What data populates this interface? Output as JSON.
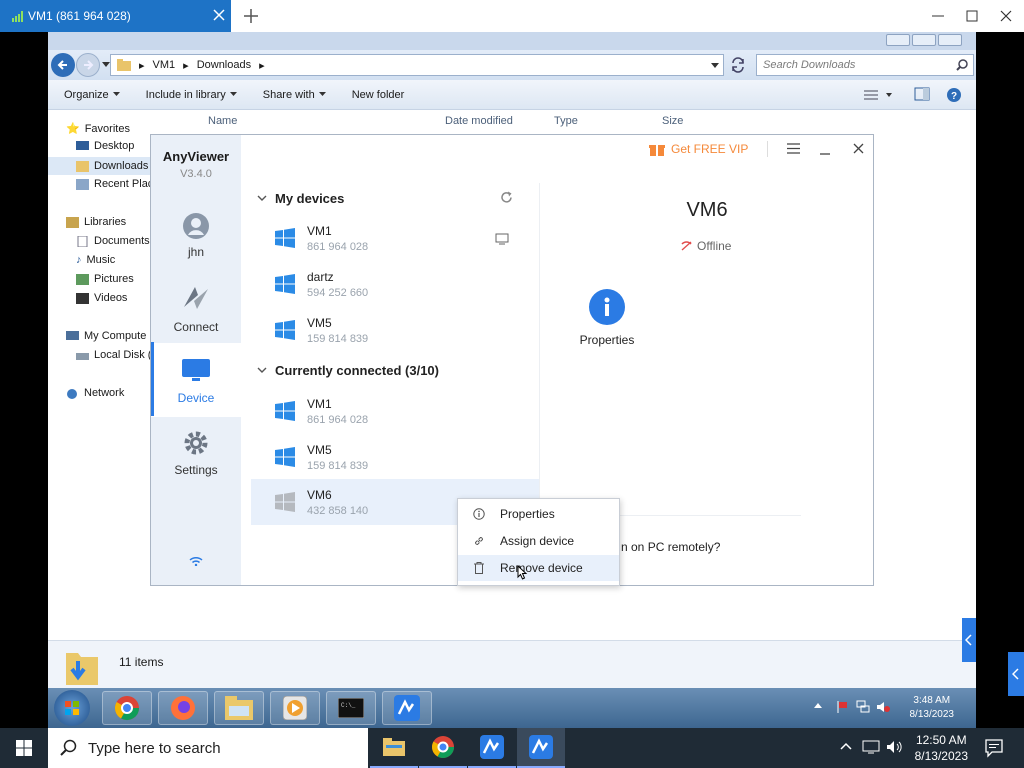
{
  "host": {
    "tab_title": "VM1 (861 964 028)",
    "search_placeholder": "Type here to search",
    "clock_time": "12:50 AM",
    "clock_date": "8/13/2023"
  },
  "explorer": {
    "breadcrumb": [
      "VM1",
      "Downloads"
    ],
    "search_placeholder": "Search Downloads",
    "toolbar": {
      "organize": "Organize",
      "include": "Include in library",
      "share": "Share with",
      "new_folder": "New folder"
    },
    "nav": {
      "favorites": "Favorites",
      "desktop": "Desktop",
      "downloads": "Downloads",
      "recent": "Recent Plac",
      "libraries": "Libraries",
      "documents": "Documents",
      "music": "Music",
      "pictures": "Pictures",
      "videos": "Videos",
      "computer": "My Compute",
      "local_disk": "Local Disk (",
      "network": "Network"
    },
    "columns": {
      "name": "Name",
      "date": "Date modified",
      "type": "Type",
      "size": "Size"
    },
    "status": "11 items"
  },
  "guest": {
    "clock_time": "3:48 AM",
    "clock_date": "8/13/2023"
  },
  "anyviewer": {
    "app_name": "AnyViewer",
    "version": "V3.4.0",
    "vip": "Get FREE VIP",
    "user": "jhn",
    "nav": {
      "connect": "Connect",
      "device": "Device",
      "settings": "Settings"
    },
    "my_devices": "My devices",
    "devices": [
      {
        "name": "VM1",
        "id": "861 964 028"
      },
      {
        "name": "dartz",
        "id": "594 252 660"
      },
      {
        "name": "VM5",
        "id": "159 814 839"
      }
    ],
    "connected_header": "Currently connected (3/10)",
    "connected": [
      {
        "name": "VM1",
        "id": "861 964 028"
      },
      {
        "name": "VM5",
        "id": "159 814 839"
      },
      {
        "name": "VM6",
        "id": "432 858 140"
      }
    ],
    "detail": {
      "name": "VM6",
      "status": "Offline",
      "properties": "Properties",
      "remote_hint": "n on PC remotely?"
    }
  },
  "context_menu": [
    "Properties",
    "Assign device",
    "Remove device"
  ],
  "colors": {
    "accent": "#2b7be4",
    "host_tab": "#1e73c6",
    "vip": "#f5893a"
  }
}
